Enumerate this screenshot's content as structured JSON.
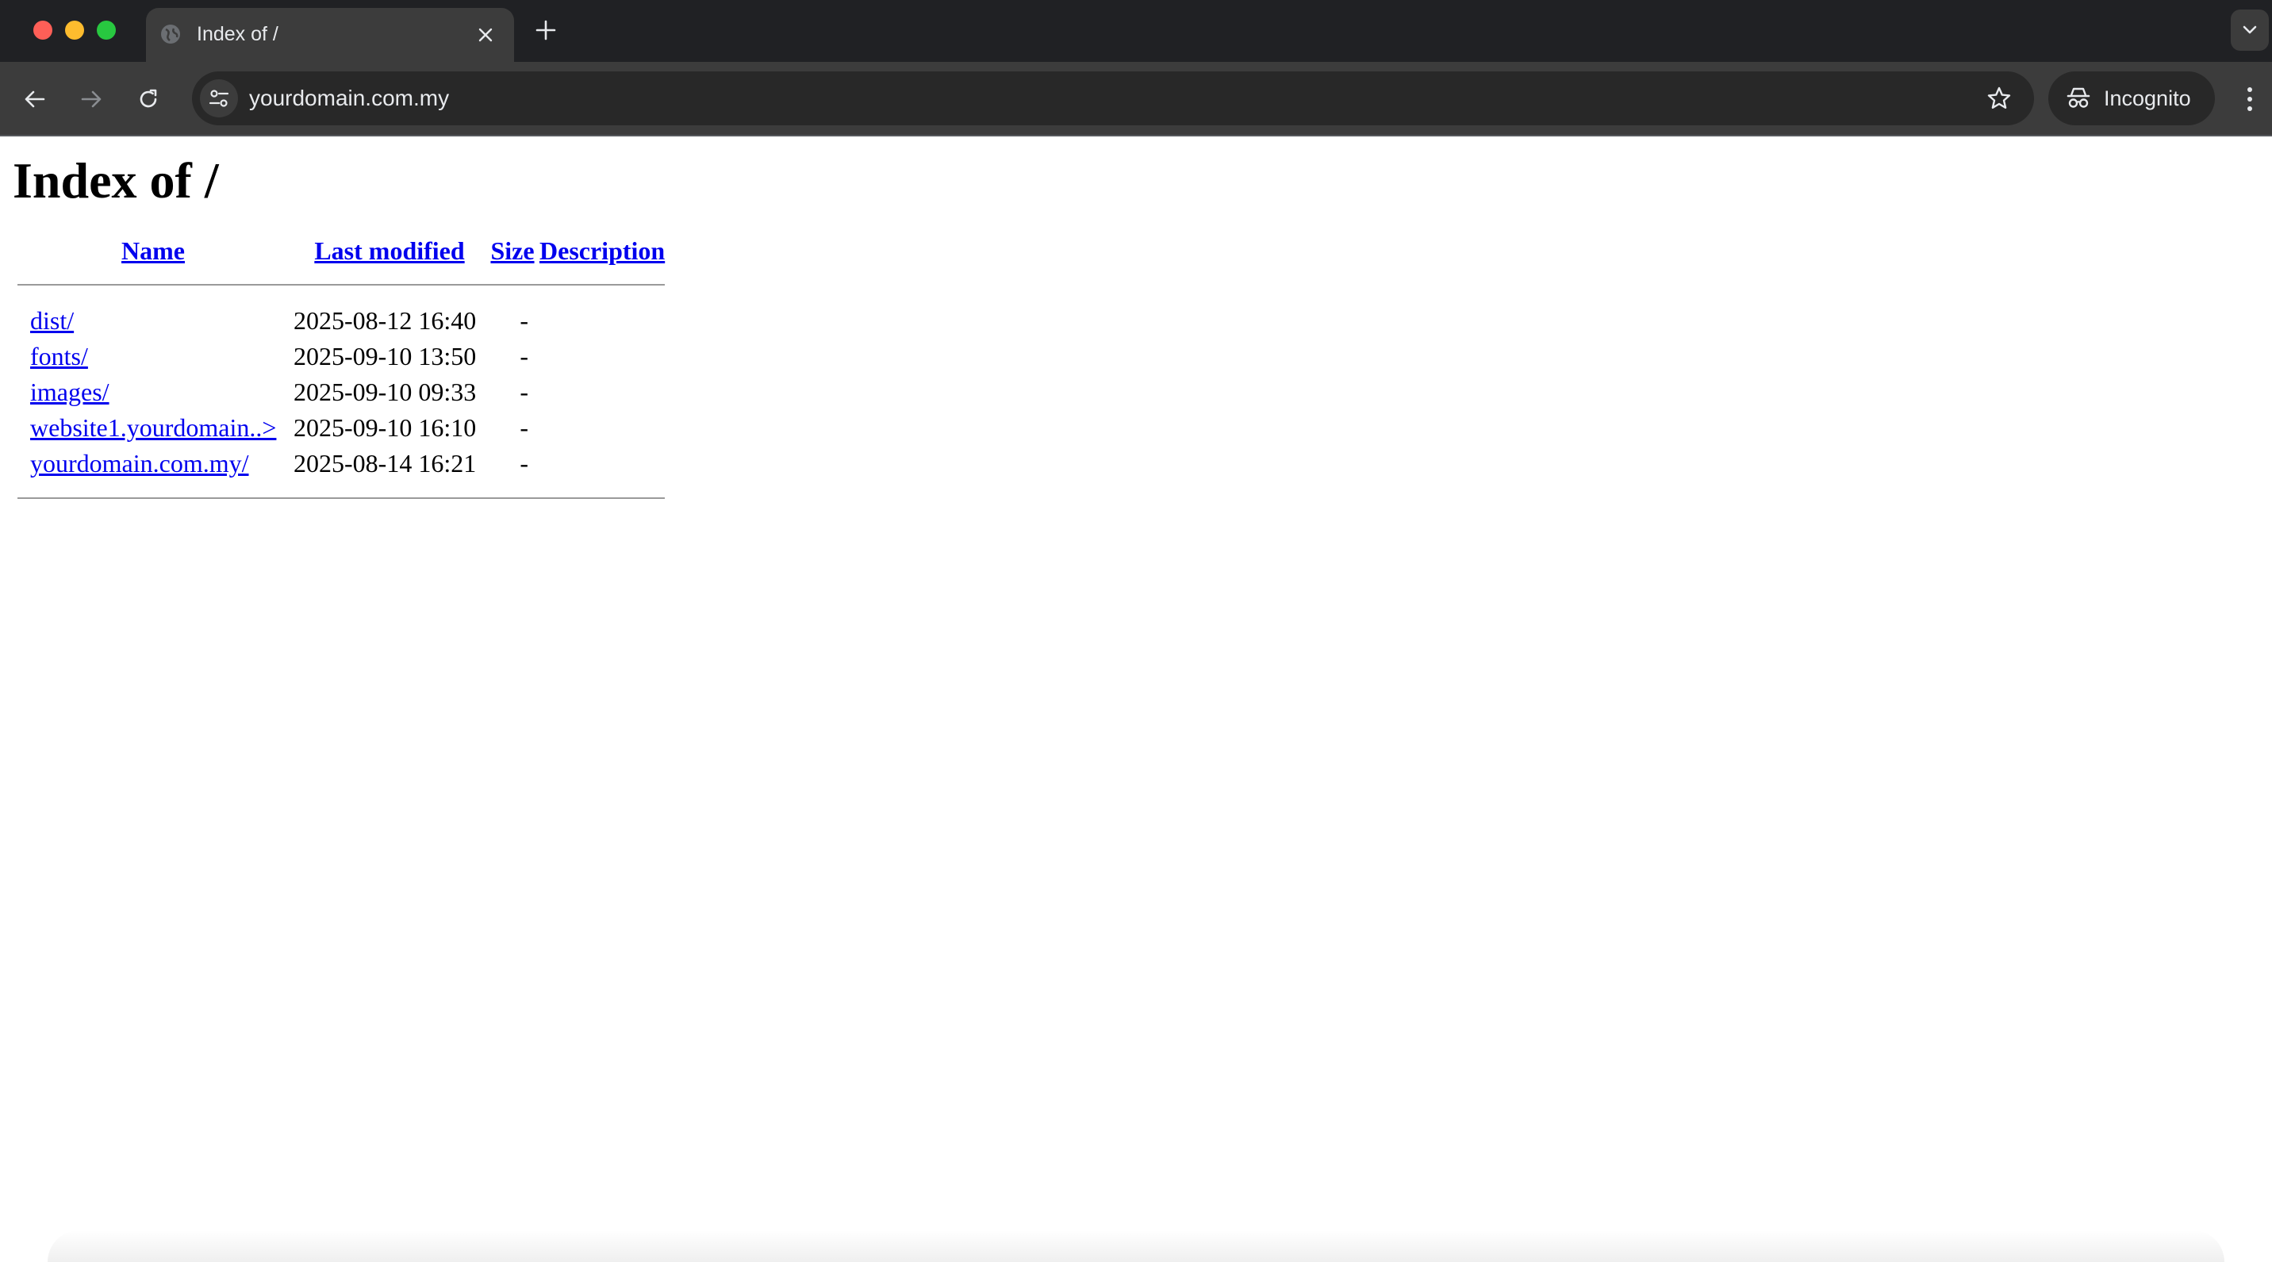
{
  "browser": {
    "tab": {
      "title": "Index of /"
    },
    "toolbar": {
      "url": "yourdomain.com.my"
    },
    "profile": {
      "label": "Incognito"
    }
  },
  "page": {
    "heading": "Index of /",
    "columns": {
      "name": "Name",
      "last_modified": "Last modified",
      "size": "Size",
      "description": "Description"
    },
    "rows": [
      {
        "name": "dist/",
        "modified": "2025-08-12 16:40",
        "size": "-",
        "description": ""
      },
      {
        "name": "fonts/",
        "modified": "2025-09-10 13:50",
        "size": "-",
        "description": ""
      },
      {
        "name": "images/",
        "modified": "2025-09-10 09:33",
        "size": "-",
        "description": ""
      },
      {
        "name": "website1.yourdomain..>",
        "modified": "2025-09-10 16:10",
        "size": "-",
        "description": ""
      },
      {
        "name": "yourdomain.com.my/",
        "modified": "2025-08-14 16:21",
        "size": "-",
        "description": ""
      }
    ]
  },
  "icons": {
    "tab_favicon": "globe-icon",
    "tab_close": "close-icon",
    "new_tab": "plus-icon",
    "tab_search": "chevron-down-icon",
    "back": "arrow-left-icon",
    "forward": "arrow-right-icon",
    "reload": "reload-icon",
    "site_info": "tune-icon",
    "bookmark": "star-icon",
    "incognito": "incognito-icon",
    "menu": "kebab-menu-icon"
  },
  "colors": {
    "link": "#0000ee",
    "tabstrip_bg": "#202124",
    "toolbar_bg": "#3c3c3c"
  }
}
